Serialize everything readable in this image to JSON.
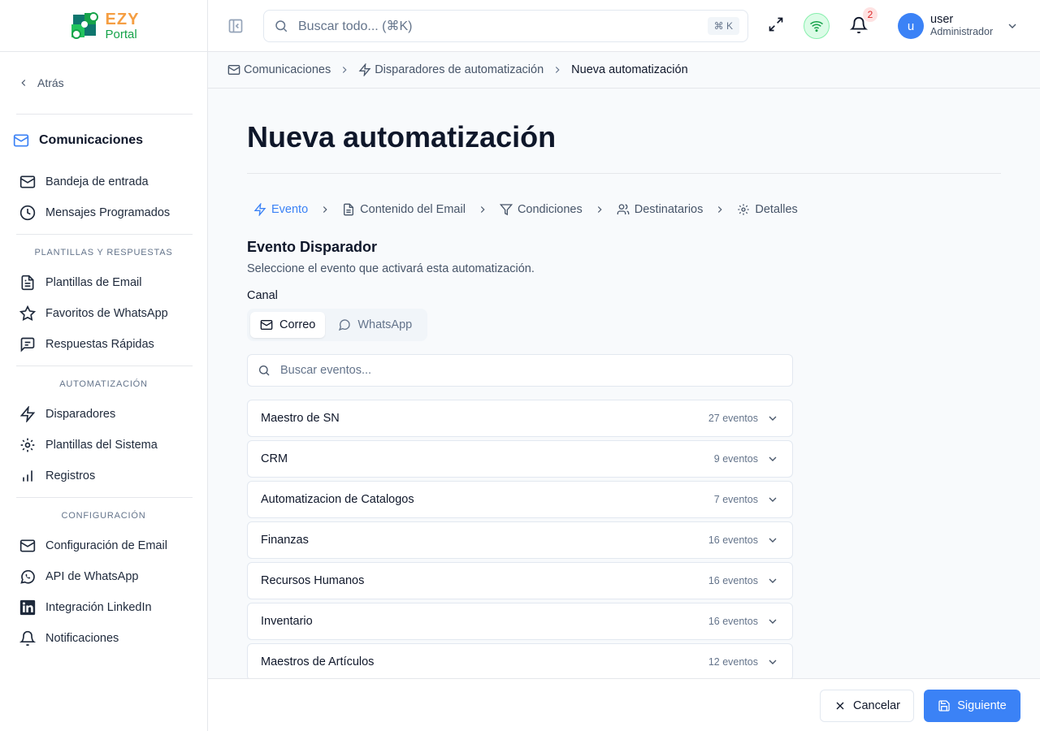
{
  "logo": {
    "top": "EZY",
    "bottom": "Portal"
  },
  "sidebar": {
    "back_label": "Atrás",
    "section_title": "Comunicaciones",
    "items_main": [
      {
        "label": "Bandeja de entrada",
        "icon": "mail-icon"
      },
      {
        "label": "Mensajes Programados",
        "icon": "clock-icon"
      }
    ],
    "group_templates": "PLANTILLAS Y RESPUESTAS",
    "items_templates": [
      {
        "label": "Plantillas de Email",
        "icon": "file-text-icon"
      },
      {
        "label": "Favoritos de WhatsApp",
        "icon": "star-icon"
      },
      {
        "label": "Respuestas Rápidas",
        "icon": "message-square-icon"
      }
    ],
    "group_automation": "AUTOMATIZACIÓN",
    "items_automation": [
      {
        "label": "Disparadores",
        "icon": "zap-icon"
      },
      {
        "label": "Plantillas del Sistema",
        "icon": "settings-icon"
      },
      {
        "label": "Registros",
        "icon": "bar-chart-icon"
      }
    ],
    "group_config": "CONFIGURACIÓN",
    "items_config": [
      {
        "label": "Configuración de Email",
        "icon": "mail-icon"
      },
      {
        "label": "API de WhatsApp",
        "icon": "whatsapp-icon"
      },
      {
        "label": "Integración LinkedIn",
        "icon": "linkedin-icon"
      },
      {
        "label": "Notificaciones",
        "icon": "bell-icon"
      }
    ]
  },
  "header": {
    "search_placeholder": "Buscar todo... (⌘K)",
    "shortcut": "⌘ K",
    "notifications_count": "2",
    "user_initial": "u",
    "user_name": "user",
    "user_role": "Administrador"
  },
  "breadcrumb": {
    "items": [
      "Comunicaciones",
      "Disparadores de automatización"
    ],
    "current": "Nueva automatización"
  },
  "main": {
    "title": "Nueva automatización",
    "steps": [
      "Evento",
      "Contenido del Email",
      "Condiciones",
      "Destinatarios",
      "Detalles"
    ],
    "active_step": "Evento",
    "section_title": "Evento Disparador",
    "section_subtitle": "Seleccione el evento que activará esta automatización.",
    "channel_label": "Canal",
    "channels": [
      "Correo",
      "WhatsApp"
    ],
    "active_channel": "Correo",
    "event_search_placeholder": "Buscar eventos...",
    "categories": [
      {
        "name": "Maestro de SN",
        "count": "27 eventos"
      },
      {
        "name": "CRM",
        "count": "9 eventos"
      },
      {
        "name": "Automatizacion de Catalogos",
        "count": "7 eventos"
      },
      {
        "name": "Finanzas",
        "count": "16 eventos"
      },
      {
        "name": "Recursos Humanos",
        "count": "16 eventos"
      },
      {
        "name": "Inventario",
        "count": "16 eventos"
      },
      {
        "name": "Maestros de Artículos",
        "count": "12 eventos"
      }
    ]
  },
  "footer": {
    "cancel_label": "Cancelar",
    "next_label": "Siguiente"
  },
  "colors": {
    "primary": "#3b82f6",
    "success": "#16a34a",
    "danger": "#dc2626"
  }
}
